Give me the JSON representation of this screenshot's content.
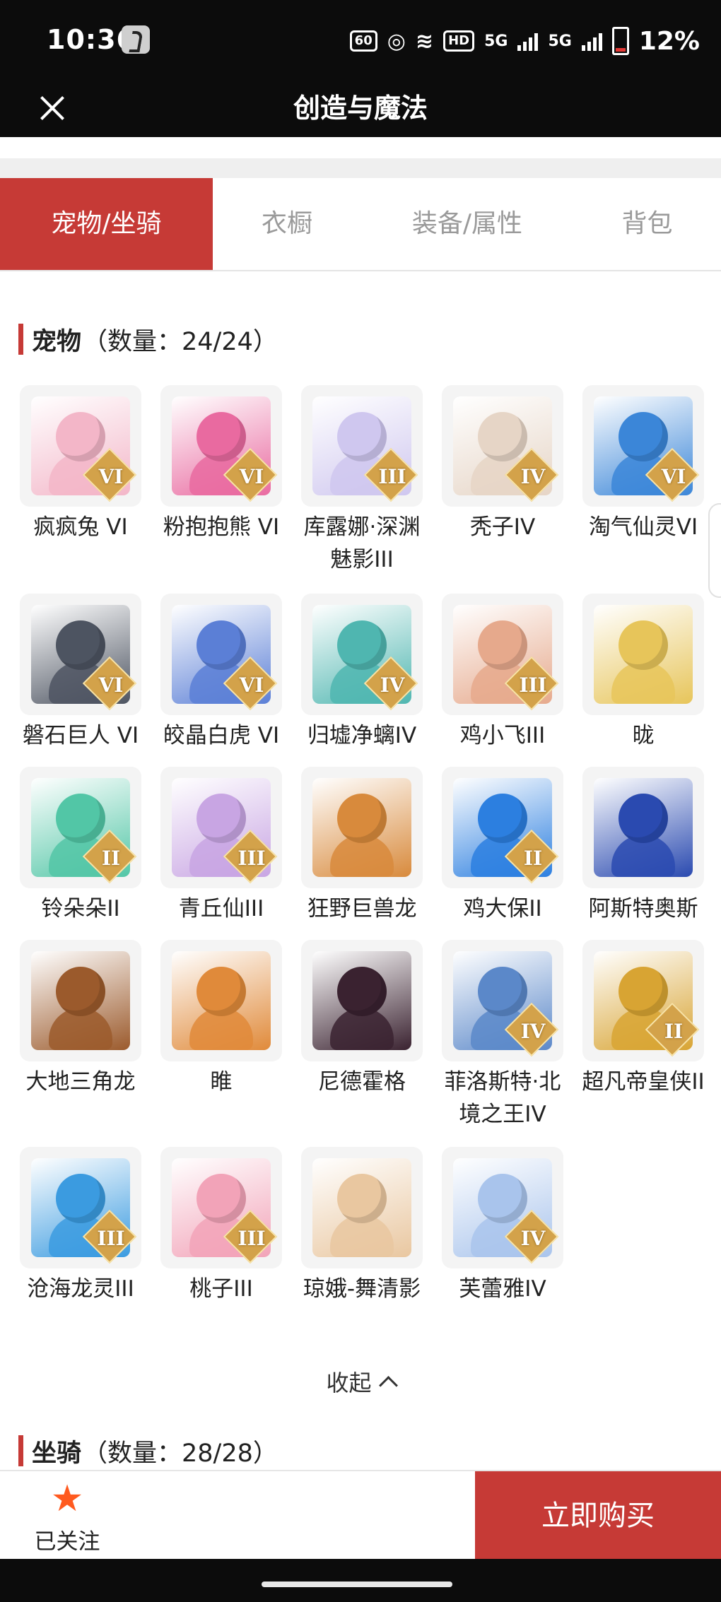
{
  "status_bar": {
    "time": "10:36",
    "refresh_badge": "60",
    "hd_badge": "HD",
    "signal_1": "5G",
    "signal_2": "5G",
    "battery": "12%"
  },
  "header": {
    "title": "创造与魔法"
  },
  "tabs": [
    {
      "label": "宠物/坐骑",
      "active": true
    },
    {
      "label": "衣橱",
      "active": false
    },
    {
      "label": "装备/属性",
      "active": false
    },
    {
      "label": "背包",
      "active": false
    }
  ],
  "pets_section": {
    "title": "宠物",
    "count": "（数量：24/24）",
    "items": [
      {
        "name": "疯疯兔 VI",
        "badge": "VI",
        "color": "#f3b6c8"
      },
      {
        "name": "粉抱抱熊 VI",
        "badge": "VI",
        "color": "#e96aa0"
      },
      {
        "name": "库露娜·深渊魅影III",
        "badge": "III",
        "color": "#cfc7ef"
      },
      {
        "name": "秃子IV",
        "badge": "IV",
        "color": "#e6d5c6"
      },
      {
        "name": "淘气仙灵VI",
        "badge": "VI",
        "color": "#3b86d8"
      },
      {
        "name": "磐石巨人 VI",
        "badge": "VI",
        "color": "#4d5461"
      },
      {
        "name": "皎晶白虎 VI",
        "badge": "VI",
        "color": "#5b7fd6"
      },
      {
        "name": "归墟净螭IV",
        "badge": "IV",
        "color": "#4fb6b0"
      },
      {
        "name": "鸡小飞III",
        "badge": "III",
        "color": "#e6a98c"
      },
      {
        "name": "昽",
        "badge": "",
        "color": "#e7c55a"
      },
      {
        "name": "铃朵朵II",
        "badge": "II",
        "color": "#52c6a6"
      },
      {
        "name": "青丘仙III",
        "badge": "III",
        "color": "#c8a5e3"
      },
      {
        "name": "狂野巨兽龙",
        "badge": "",
        "color": "#d88a3c"
      },
      {
        "name": "鸡大保II",
        "badge": "II",
        "color": "#2c7fe0"
      },
      {
        "name": "阿斯特奥斯",
        "badge": "",
        "color": "#2a4ab0"
      },
      {
        "name": "大地三角龙",
        "badge": "",
        "color": "#9b5a2c"
      },
      {
        "name": "睢",
        "badge": "",
        "color": "#e08a3a"
      },
      {
        "name": "尼德霍格",
        "badge": "",
        "color": "#3a2230"
      },
      {
        "name": "菲洛斯特·北境之王IV",
        "badge": "IV",
        "color": "#5b88c9"
      },
      {
        "name": "超凡帝皇侠II",
        "badge": "II",
        "color": "#d8a433"
      },
      {
        "name": "沧海龙灵III",
        "badge": "III",
        "color": "#3b9be0"
      },
      {
        "name": "桃子III",
        "badge": "III",
        "color": "#f2a3b8"
      },
      {
        "name": "琼娥-舞清影",
        "badge": "",
        "color": "#e9c7a0"
      },
      {
        "name": "芙蕾雅IV",
        "badge": "IV",
        "color": "#a9c4ec"
      }
    ]
  },
  "collapse_label": "收起",
  "mounts_section": {
    "title": "坐骑",
    "count": "（数量：28/28）"
  },
  "bottom_bar": {
    "follow_label": "已关注",
    "buy_label": "立即购买"
  },
  "colors": {
    "accent": "#c63a36",
    "star": "#ff5a1f"
  }
}
